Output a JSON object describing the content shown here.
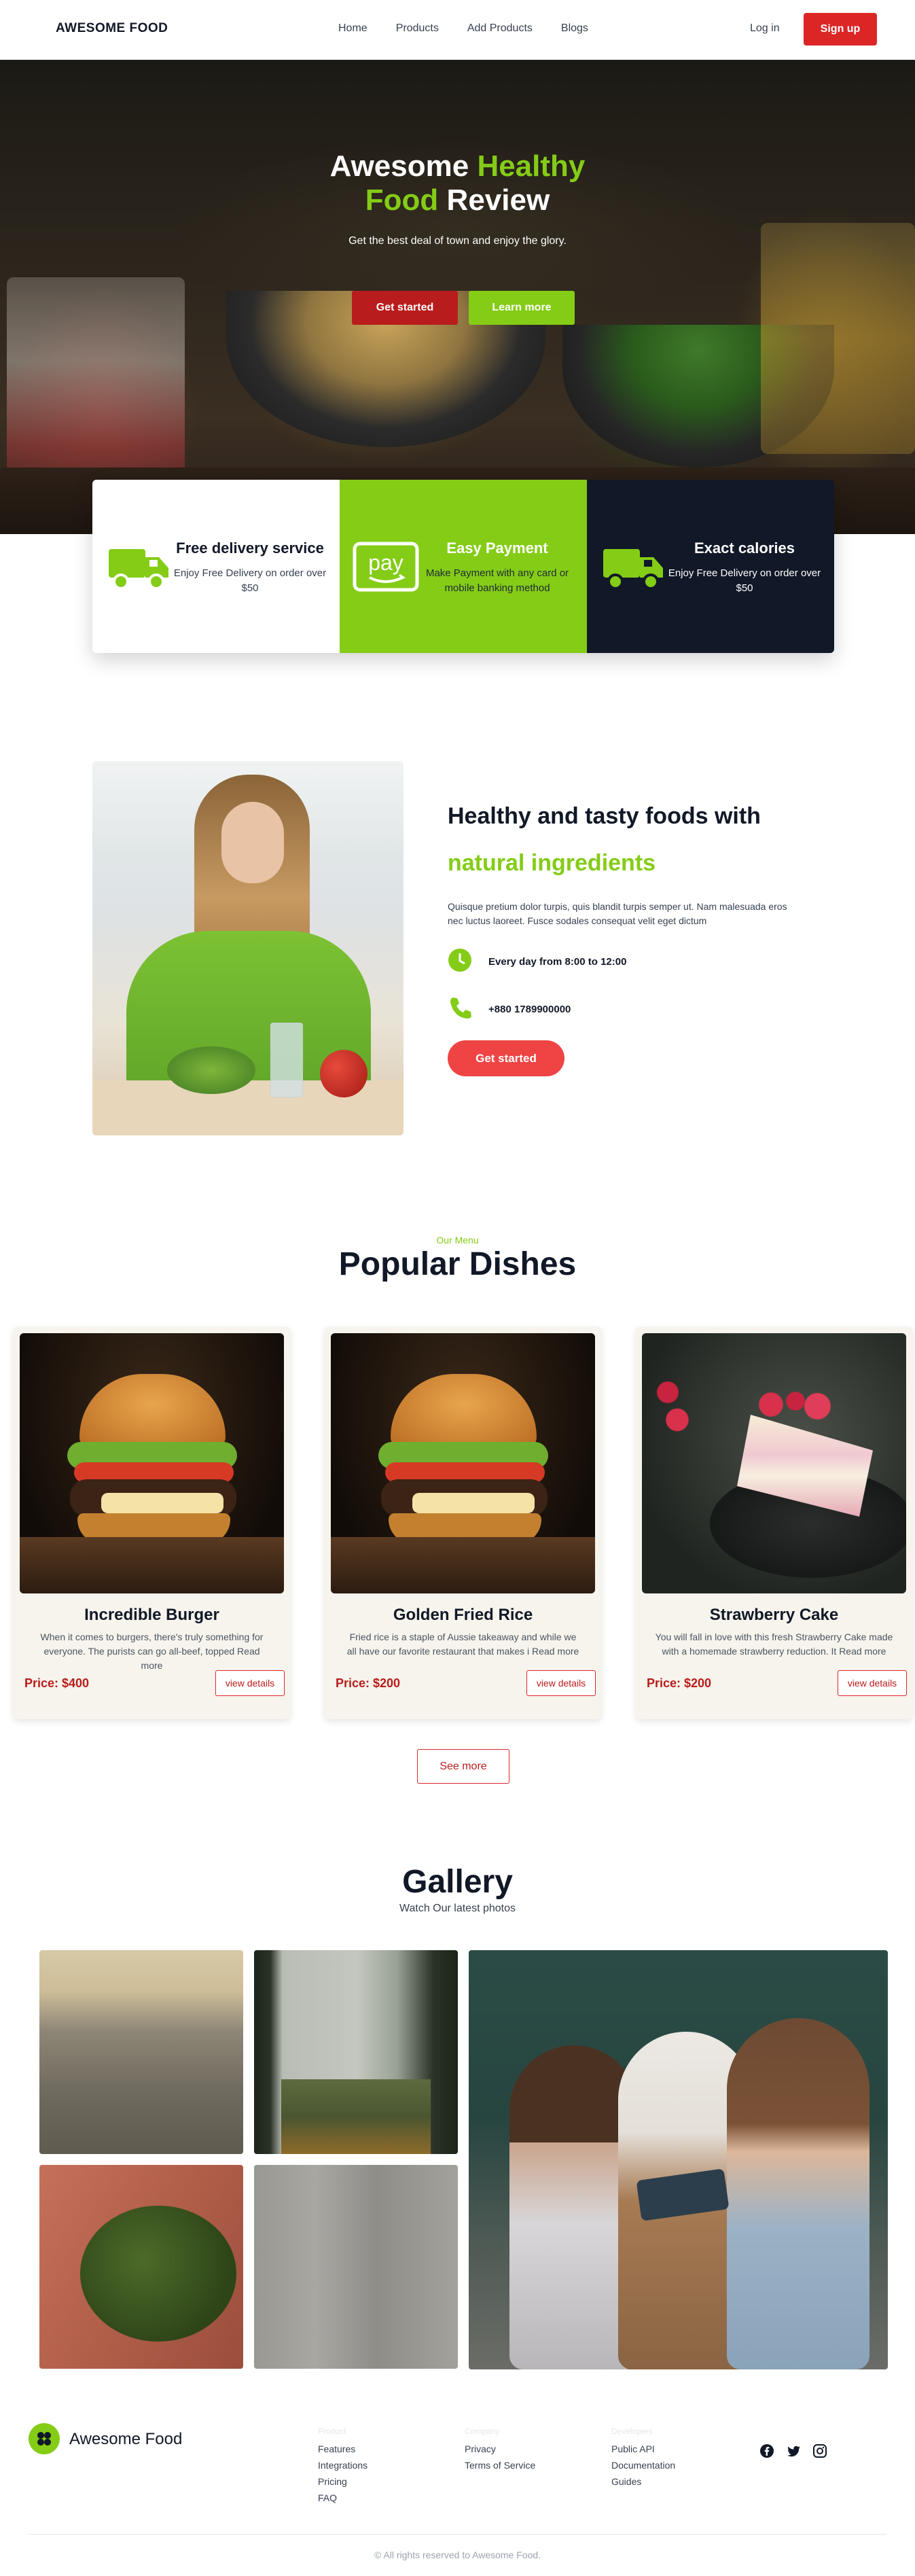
{
  "nav": {
    "brand": "AWESOME FOOD",
    "links": [
      "Home",
      "Products",
      "Add Products",
      "Blogs"
    ],
    "login": "Log in",
    "signup": "Sign up"
  },
  "hero": {
    "title_part1": "Awesome ",
    "title_part2": "Healthy",
    "title_part3": "Food",
    "title_part4": " Review",
    "subtitle": "Get the best deal of town and enjoy the glory.",
    "primary_button": "Get started",
    "secondary_button": "Learn more"
  },
  "features": [
    {
      "icon": "delivery-truck-icon",
      "title": "Free delivery service",
      "text": "Enjoy Free Delivery on order over $50"
    },
    {
      "icon": "amazon-pay-icon",
      "title": "Easy Payment",
      "text": "Make Payment with any card or mobile banking method"
    },
    {
      "icon": "delivery-truck-icon",
      "title": "Exact calories",
      "text": "Enjoy Free Delivery on order over $50"
    }
  ],
  "about": {
    "heading": "Healthy and tasty foods with",
    "heading_accent": "natural ingredients",
    "paragraph": "Quisque pretium dolor turpis, quis blandit turpis semper ut. Nam malesuada eros nec luctus laoreet. Fusce sodales consequat velit eget dictum",
    "hours": "Every day from 8:00 to 12:00",
    "phone": "+880 1789900000",
    "button": "Get started"
  },
  "menu": {
    "tag": "Our Menu",
    "title": "Popular Dishes",
    "see_more": "See more",
    "dishes": [
      {
        "name": "Incredible Burger",
        "description": "When it comes to burgers, there's truly something for everyone. The purists can go all-beef, topped Read more",
        "price": "Price: $400",
        "button": "view details"
      },
      {
        "name": "Golden Fried Rice",
        "description": "Fried rice is a staple of Aussie takeaway and while we all have our favorite restaurant that makes i Read more",
        "price": "Price: $200",
        "button": "view details"
      },
      {
        "name": "Strawberry Cake",
        "description": "You will fall in love with this fresh Strawberry Cake made with a homemade strawberry reduction. It Read more",
        "price": "Price: $200",
        "button": "view details"
      }
    ]
  },
  "gallery": {
    "title": "Gallery",
    "subtitle": "Watch Our latest photos"
  },
  "footer": {
    "brand": "Awesome Food",
    "columns": [
      {
        "heading": "Product",
        "links": [
          "Features",
          "Integrations",
          "Pricing",
          "FAQ"
        ]
      },
      {
        "heading": "Company",
        "links": [
          "Privacy",
          "Terms of Service"
        ]
      },
      {
        "heading": "Developers",
        "links": [
          "Public API",
          "Documentation",
          "Guides"
        ]
      }
    ],
    "social": [
      "facebook-icon",
      "twitter-icon",
      "instagram-icon"
    ],
    "copyright": "© All rights reserved to Awesome Food."
  },
  "colors": {
    "accent_green": "#84cc16",
    "accent_red": "#dc2626",
    "dark_navy": "#111827"
  }
}
